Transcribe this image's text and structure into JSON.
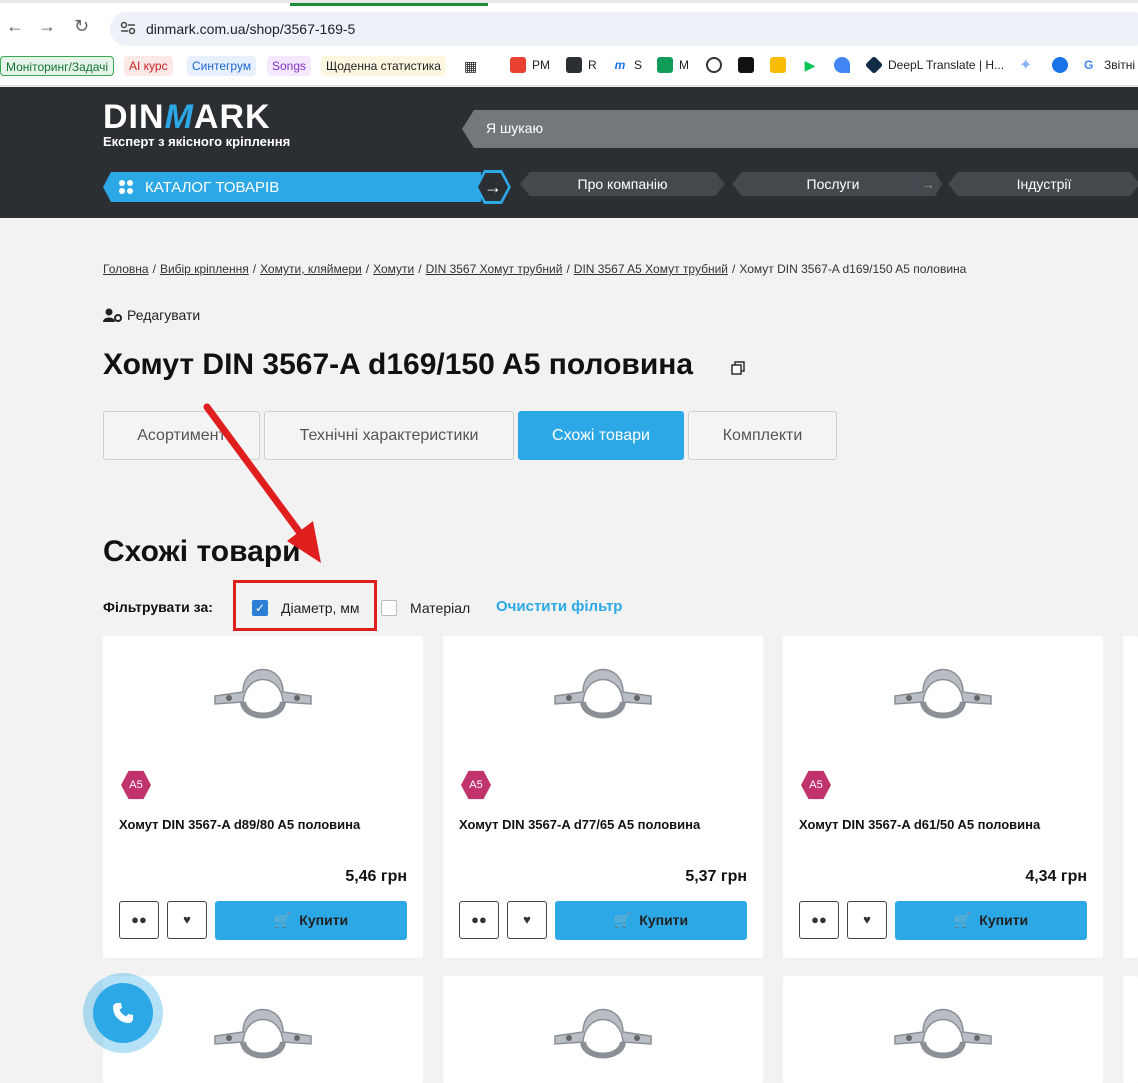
{
  "browser": {
    "url": "dinmark.com.ua/shop/3567-169-5",
    "bookmarks": [
      "Моніторинг/Задачі",
      "AI курс",
      "Синтегрум",
      "Songs",
      "Щоденна статистика",
      "PM",
      "R",
      "S",
      "M",
      "DeepL Translate | H...",
      "Звітні"
    ]
  },
  "header": {
    "logo_left": "DIN",
    "logo_mid": "M",
    "logo_right": "ARK",
    "tagline": "Експерт з якісного кріплення",
    "search_placeholder": "Я шукаю",
    "catalog_label": "КАТАЛОГ ТОВАРІВ",
    "menu": [
      "Про компанію",
      "Послуги",
      "Індустрії"
    ]
  },
  "breadcrumb": [
    "Головна",
    "Вибір кріплення",
    "Хомути, кляймери",
    "Хомути",
    "DIN 3567 Хомут трубний",
    "DIN 3567 A5 Хомут трубний",
    "Хомут DIN 3567-A d169/150 A5 половина"
  ],
  "edit_label": "Редагувати",
  "title": "Хомут DIN 3567-A d169/150 A5 половина",
  "tabs": [
    "Асортимент",
    "Технічні характеристики",
    "Схожі товари",
    "Комплекти"
  ],
  "section_title": "Схожі товари",
  "filter": {
    "label": "Фільтрувати за:",
    "options": [
      {
        "label": "Діаметр, мм",
        "checked": true
      },
      {
        "label": "Матеріал",
        "checked": false
      }
    ],
    "clear_label": "Очистити фільтр"
  },
  "products": [
    {
      "badge": "A5",
      "name": "Хомут DIN 3567-A d89/80 A5 половина",
      "price": "5,46 грн",
      "buy_label": "Купити"
    },
    {
      "badge": "A5",
      "name": "Хомут DIN 3567-A d77/65 A5 половина",
      "price": "5,37 грн",
      "buy_label": "Купити"
    },
    {
      "badge": "A5",
      "name": "Хомут DIN 3567-A d61/50 A5 половина",
      "price": "4,34 грн",
      "buy_label": "Купити"
    }
  ],
  "colors": {
    "accent": "#2ca8e6",
    "header_bg": "#2b2e32",
    "badge": "#c0336b",
    "annotation": "#e01e1e"
  }
}
